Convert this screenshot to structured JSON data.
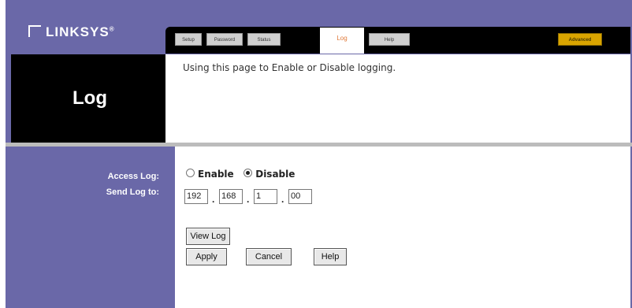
{
  "brand": {
    "logo_text": "LINKSYS",
    "trademark": "®"
  },
  "tabs": [
    {
      "label": "Setup"
    },
    {
      "label": "Password"
    },
    {
      "label": "Status"
    },
    {
      "label": "Log",
      "active": true
    },
    {
      "label": "Help"
    }
  ],
  "advanced_tab": {
    "label": "Advanced"
  },
  "page": {
    "title": "Log",
    "description": "Using this page to Enable or Disable logging."
  },
  "access_log": {
    "label": "Access Log:",
    "options": [
      {
        "label": "Enable",
        "selected": false
      },
      {
        "label": "Disable",
        "selected": true
      }
    ]
  },
  "send_log": {
    "label": "Send Log to:",
    "octets": [
      "192",
      "168",
      "1",
      "00"
    ],
    "separator": "."
  },
  "buttons": {
    "view_log": "View Log",
    "apply": "Apply",
    "cancel": "Cancel",
    "help": "Help"
  },
  "colors": {
    "sidebar": "#6a68a8",
    "header_black": "#000000",
    "advanced_tab": "#d9a400",
    "active_tab_text": "#e07a3a"
  }
}
